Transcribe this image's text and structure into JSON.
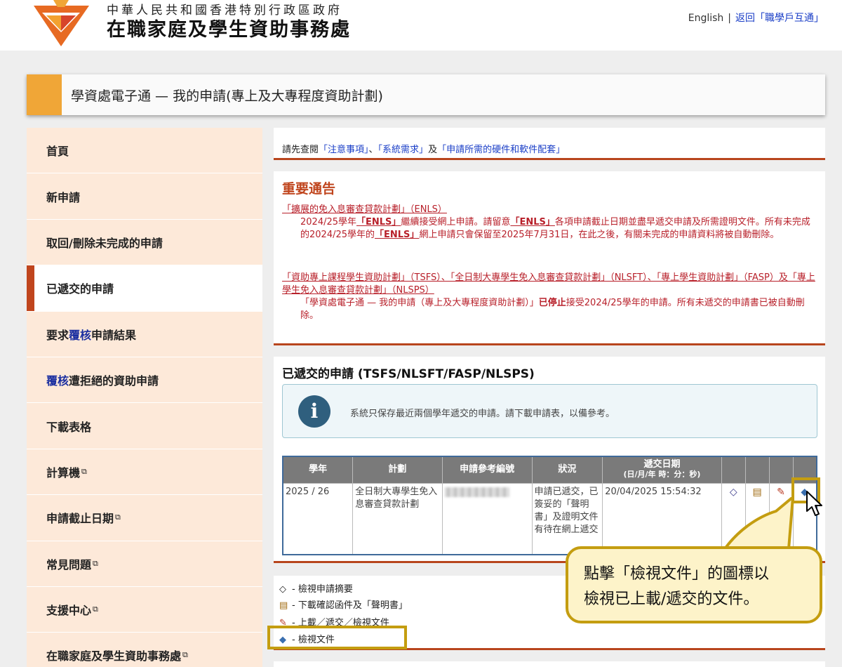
{
  "header": {
    "org_sub": "中華人民共和國香港特別行政區政府",
    "org_main": "在職家庭及學生資助事務處",
    "lang_link": "English",
    "separator": "|",
    "back_link": "返回「職學戶互通」",
    "logo_icon": "wfsfaa-logo-icon"
  },
  "page_title": "學資處電子通 — 我的申請(專上及大專程度資助計劃)",
  "sidebar": {
    "items": [
      {
        "label": "首頁"
      },
      {
        "label": "新申請"
      },
      {
        "label": "取回/刪除未完成的申請"
      },
      {
        "label": "已遞交的申請"
      },
      {
        "pre": "要求",
        "kw": "覆核",
        "post": "申請結果"
      },
      {
        "pre": "",
        "kw": "覆核",
        "post": "遭拒絕的資助申請"
      },
      {
        "label": "下載表格"
      },
      {
        "label": "計算機"
      },
      {
        "label": "申請截止日期"
      },
      {
        "label": "常見問題"
      },
      {
        "label": "支援中心"
      },
      {
        "label": "在職家庭及學生資助事務處"
      }
    ],
    "active_index": 3
  },
  "notice_line": {
    "pre": "請先查閱",
    "link1": "「注意事項」",
    "mid1": "、",
    "link2": "「系統需求」",
    "mid2": "及",
    "link3": "「申請所需的硬件和軟件配套」"
  },
  "important": {
    "heading": "重要通告",
    "n1_title": "「擴展的免入息審查貸款計劃」（ENLS）",
    "n1_a": "2024/25學年",
    "n1_b": "「ENLS」",
    "n1_c": "繼續接受網上申請。請留意",
    "n1_d": "「ENLS」",
    "n1_e": "各項申請截止日期並盡早遞交申請及所需證明文件。所有未完成的2024/25學年的",
    "n1_f": "「ENLS」",
    "n1_g": "網上申請只會保留至2025年7月31日，在此之後，有關未完成的申請資料將被自動刪除。",
    "n2_title": "「資助專上課程學生資助計劃」（TSFS）、「全日制大專學生免入息審查貸款計劃」（NLSFT）、「專上學生資助計劃」（FASP）及「專上學生免入息審查貸款計劃」（NLSPS）",
    "n2_a": "「學資處電子通 — 我的申請（專上及大專程度資助計劃）」",
    "n2_b": "已停止",
    "n2_c": "接受2024/25學年的申請。所有未遞交的申請書已被自動刪除。"
  },
  "submitted": {
    "heading": "已遞交的申請 (TSFS/NLSFT/FASP/NLSPS)",
    "info_icon": "info-icon",
    "info_msg": "系統只保存最近兩個學年遞交的申請。請下載申請表，以備參考。",
    "columns": {
      "year": "學年",
      "scheme": "計劃",
      "ref": "申請參考編號",
      "status": "狀況",
      "date": "遞交日期",
      "date_sub": "(日/月/年 時：分：秒)"
    },
    "row": {
      "year": "2025 / 26",
      "scheme": "全日制大專學生免入息審查貸款計劃",
      "status": "申請已遞交，已簽妥的「聲明書」及證明文件有待在網上遞交",
      "date": "20/04/2025 15:54:32"
    }
  },
  "legend": [
    {
      "icon": "summary-icon",
      "label": "- 檢視申請摘要"
    },
    {
      "icon": "download-notice-icon",
      "label": "- 下載確認函件及「聲明書」"
    },
    {
      "icon": "upload-icon",
      "label": "- 上載／遞交／檢視文件"
    },
    {
      "icon": "view-documents-icon",
      "label": "- 檢視文件"
    }
  ],
  "callout": {
    "line1": "點擊「檢視文件」的圖標以",
    "line2": "檢視已上載/遞交的文件。"
  },
  "colors": {
    "accent_orange": "#f0a637",
    "accent_red": "#c0451d",
    "sidebar_bg": "#fde9d9",
    "highlight_gold": "#c49d10"
  }
}
